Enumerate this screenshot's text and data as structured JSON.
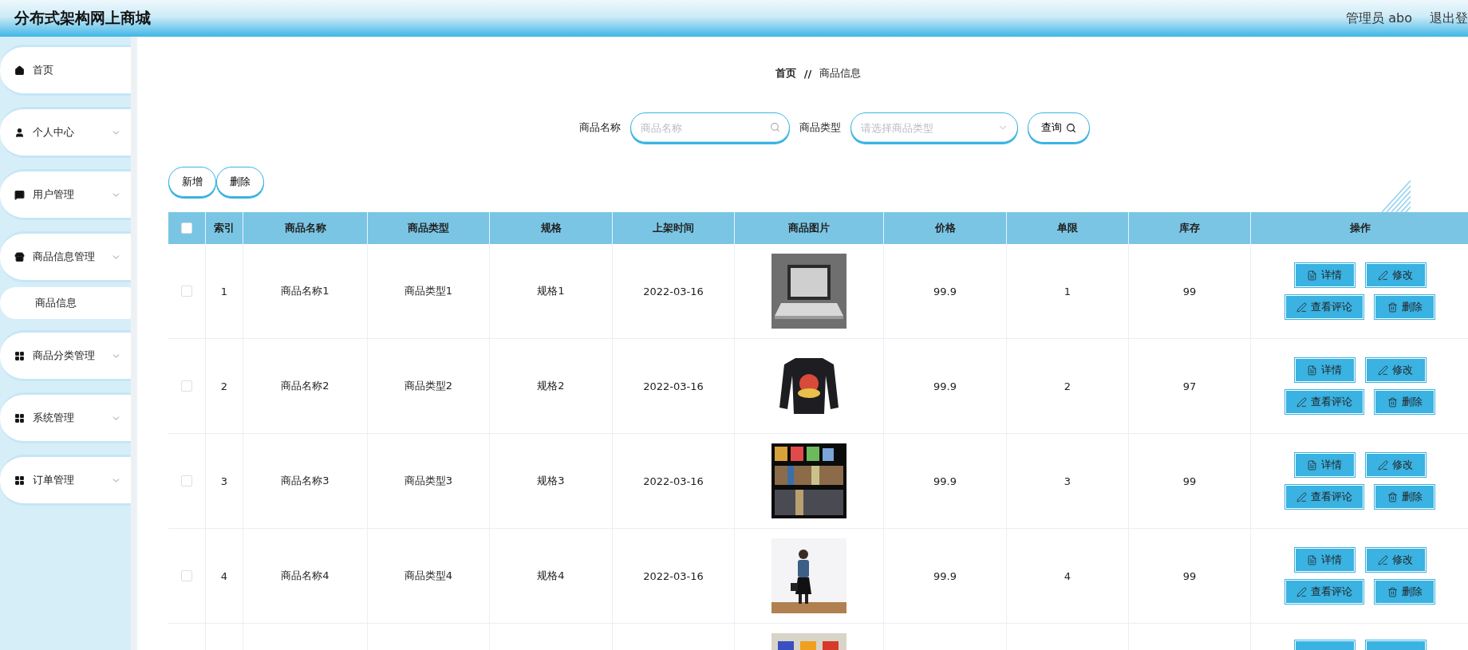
{
  "app_title": "分布式架构网上商城",
  "user": {
    "role_name": "管理员 abo",
    "logout": "退出登"
  },
  "sidebar": {
    "items": [
      {
        "label": "首页",
        "expandable": false
      },
      {
        "label": "个人中心",
        "expandable": true
      },
      {
        "label": "用户管理",
        "expandable": true
      },
      {
        "label": "商品信息管理",
        "expandable": true,
        "children": [
          {
            "label": "商品信息"
          }
        ]
      },
      {
        "label": "商品分类管理",
        "expandable": true
      },
      {
        "label": "系统管理",
        "expandable": true
      },
      {
        "label": "订单管理",
        "expandable": true
      }
    ]
  },
  "breadcrumb": {
    "items": [
      "首页",
      "商品信息"
    ],
    "separator": "//"
  },
  "search": {
    "fields": [
      {
        "label": "商品名称",
        "placeholder": "商品名称",
        "kind": "text"
      },
      {
        "label": "商品类型",
        "placeholder": "请选择商品类型",
        "kind": "select"
      }
    ],
    "button": "查询"
  },
  "toolbar": [
    "新增",
    "删除"
  ],
  "table": {
    "select_all_checked": false,
    "columns": [
      "索引",
      "商品名称",
      "商品类型",
      "规格",
      "上架时间",
      "商品图片",
      "价格",
      "单限",
      "库存",
      "操作"
    ],
    "rows": [
      {
        "kind": "full",
        "checked": false,
        "cells": [
          "1",
          "商品名称1",
          "商品类型1",
          "规格1",
          "2022-03-16"
        ],
        "picture": {
          "kind": "picture"
        },
        "cells_after": [
          "99.9",
          "1",
          "99"
        ],
        "actions": [
          "详情",
          "修改",
          "查看评论",
          "删除"
        ]
      },
      {
        "kind": "full",
        "checked": false,
        "cells": [
          "2",
          "商品名称2",
          "商品类型2",
          "规格2",
          "2022-03-16"
        ],
        "picture": {
          "kind": "picture"
        },
        "cells_after": [
          "99.9",
          "2",
          "97"
        ],
        "actions": [
          "详情",
          "修改",
          "查看评论",
          "删除"
        ]
      },
      {
        "kind": "full",
        "checked": false,
        "cells": [
          "3",
          "商品名称3",
          "商品类型3",
          "规格3",
          "2022-03-16"
        ],
        "picture": {
          "kind": "picture"
        },
        "cells_after": [
          "99.9",
          "3",
          "99"
        ],
        "actions": [
          "详情",
          "修改",
          "查看评论",
          "删除"
        ]
      },
      {
        "kind": "full",
        "checked": false,
        "cells": [
          "4",
          "商品名称4",
          "商品类型4",
          "规格4",
          "2022-03-16"
        ],
        "picture": {
          "kind": "picture"
        },
        "cells_after": [
          "99.9",
          "4",
          "99"
        ],
        "actions": [
          "详情",
          "修改",
          "查看评论",
          "删除"
        ]
      },
      {
        "kind": "cut_off",
        "picture": {
          "kind": "picture"
        }
      }
    ]
  }
}
